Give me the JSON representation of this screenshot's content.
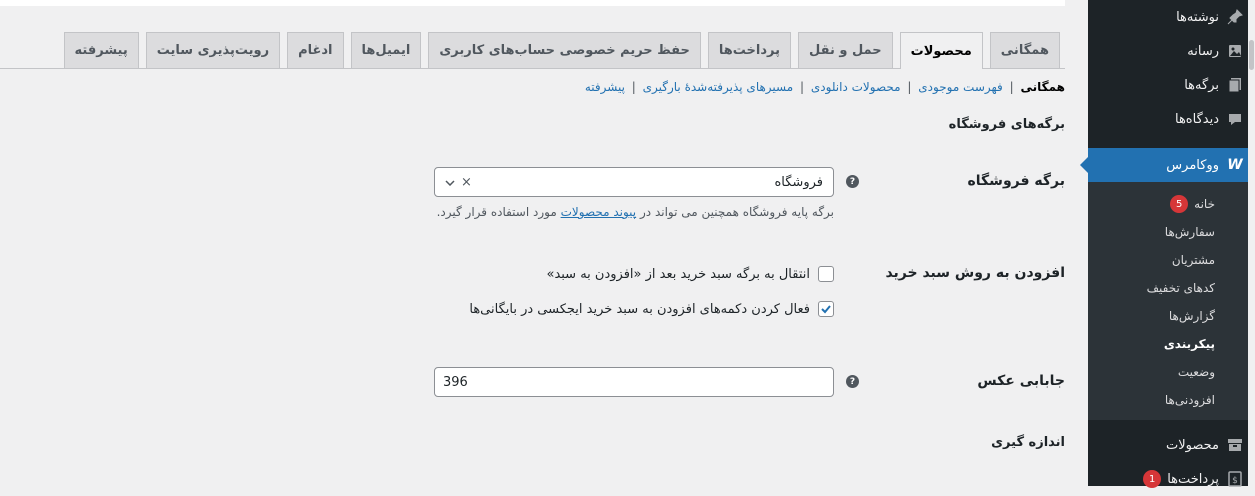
{
  "sidebar": {
    "items_top": [
      {
        "label": "نوشته‌ها",
        "icon": "pushpin-icon"
      },
      {
        "label": "رسانه",
        "icon": "media-icon"
      },
      {
        "label": "برگه‌ها",
        "icon": "pages-icon"
      },
      {
        "label": "دیدگاه‌ها",
        "icon": "comments-icon"
      }
    ],
    "current": {
      "label": "ووکامرس",
      "icon": "woocommerce-icon",
      "icon_text": "W"
    },
    "submenu": [
      {
        "label": "خانه",
        "badge": "5"
      },
      {
        "label": "سفارش‌ها"
      },
      {
        "label": "مشتریان"
      },
      {
        "label": "کدهای تخفیف"
      },
      {
        "label": "گزارش‌ها"
      },
      {
        "label": "پیکربندی"
      },
      {
        "label": "وضعیت"
      },
      {
        "label": "افزودنی‌ها"
      }
    ],
    "items_bottom": [
      {
        "label": "محصولات",
        "icon": "products-icon"
      },
      {
        "label": "پرداخت‌ها",
        "icon": "payments-icon",
        "badge": "1"
      }
    ]
  },
  "tabs": [
    "همگانی",
    "محصولات",
    "حمل و نقل",
    "پرداخت‌ها",
    "حفظ حریم خصوصی حساب‌های کاربری",
    "ایمیل‌ها",
    "ادغام",
    "رویت‌پذیری سایت",
    "پیشرفته"
  ],
  "active_tab": 1,
  "subsub": {
    "current": "همگانی",
    "links": [
      "فهرست موجودی",
      "محصولات دانلودی",
      "مسیرهای پذیرفته‌شدهٔ بارگیری",
      "پیشرفته"
    ],
    "separator": "|"
  },
  "section_title": "برگه‌های فروشگاه",
  "shop_page": {
    "label": "برگه فروشگاه",
    "help": "?",
    "value": "فروشگاه",
    "clear_glyph": "×",
    "arrow_glyph": "⌄",
    "desc_before": "برگه پایه فروشگاه همچنین می تواند در",
    "desc_link": "پیوند محصولات",
    "desc_after": "مورد استفاده قرار گیرد."
  },
  "add_to_cart": {
    "label": "افزودن به روش سبد خرید",
    "options": [
      {
        "text": "انتقال به برگه سبد خرید بعد از «افزودن به سبد»",
        "checked": false
      },
      {
        "text": "فعال کردن دکمه‌های افزودن به سبد خرید ایجکسی در بایگانی‌ها",
        "checked": true
      }
    ]
  },
  "placeholder_image": {
    "label": "جابابی عکس",
    "help": "?",
    "value": "396"
  },
  "measurements_title": "اندازه گیری",
  "colors": {
    "sidebar_bg": "#1d2327",
    "submenu_bg": "#2c3338",
    "accent": "#2271b1",
    "badge": "#d63638",
    "content_bg": "#f0f0f1"
  }
}
